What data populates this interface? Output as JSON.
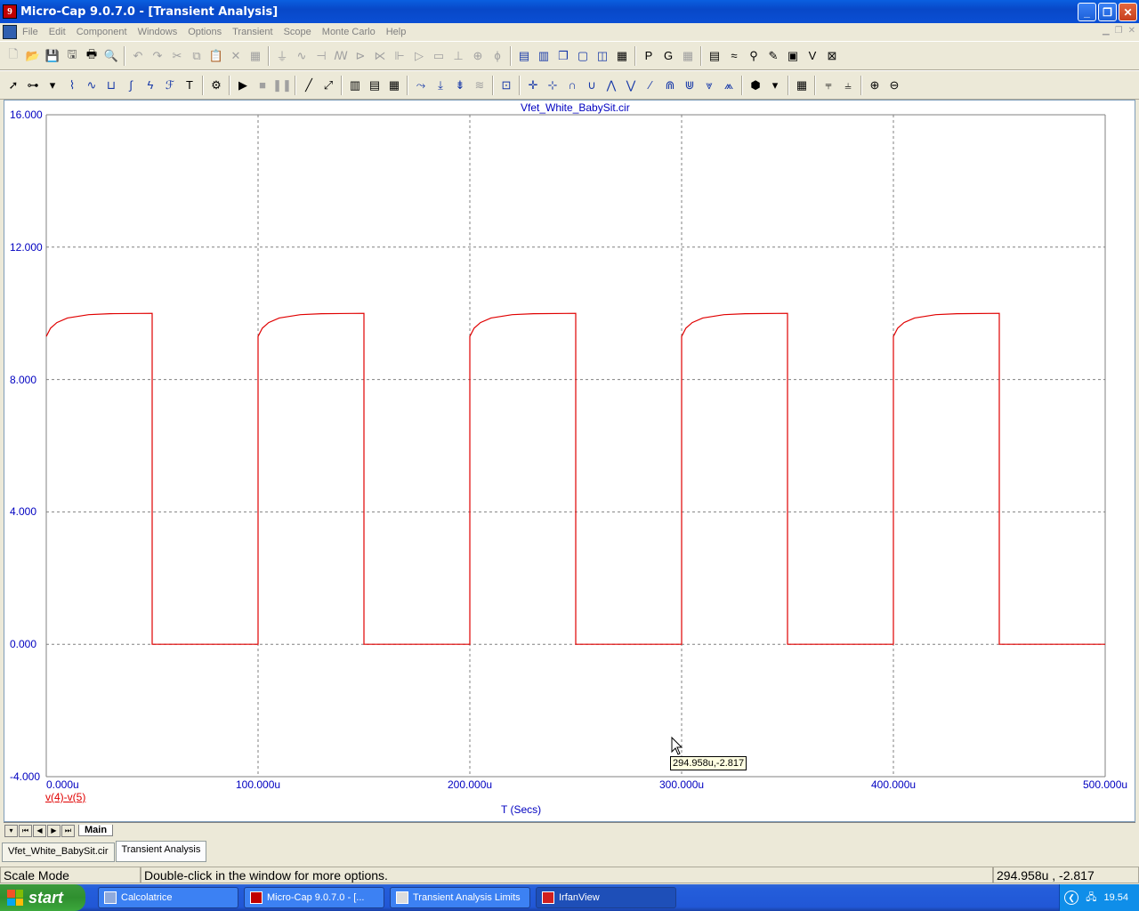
{
  "window": {
    "title": "Micro-Cap 9.0.7.0 - [Transient Analysis]",
    "app_icon_glyph": "9",
    "minimize_glyph": "_",
    "restore_glyph": "❐",
    "close_glyph": "✕"
  },
  "menu": {
    "items": [
      "File",
      "Edit",
      "Component",
      "Windows",
      "Options",
      "Transient",
      "Scope",
      "Monte Carlo",
      "Help"
    ]
  },
  "plot": {
    "title": "Vfet_White_BabySit.cir",
    "y_ticks": [
      "16.000",
      "12.000",
      "8.000",
      "4.000",
      "0.000",
      "-4.000"
    ],
    "x_ticks": [
      "0.000u",
      "100.000u",
      "200.000u",
      "300.000u",
      "400.000u",
      "500.000u"
    ],
    "x_axis_title": "T (Secs)",
    "trace_label": "v(4)-v(5)",
    "trace_color": "#e00000",
    "cursor_tooltip": "294.958u,-2.817"
  },
  "chart_data": {
    "type": "line",
    "title": "Vfet_White_BabySit.cir",
    "xlabel": "T (Secs)",
    "ylabel": "",
    "xlim": [
      0,
      500
    ],
    "ylim": [
      -4,
      16
    ],
    "x_unit": "u",
    "grid": true,
    "series": [
      {
        "name": "v(4)-v(5)",
        "period": 100,
        "high_duration": 50,
        "points": [
          [
            0,
            9.3
          ],
          [
            2,
            9.55
          ],
          [
            5,
            9.72
          ],
          [
            10,
            9.86
          ],
          [
            20,
            9.96
          ],
          [
            30,
            9.99
          ],
          [
            50,
            10.0
          ],
          [
            50,
            0
          ],
          [
            100,
            0
          ],
          [
            100,
            9.3
          ],
          [
            102,
            9.55
          ],
          [
            105,
            9.72
          ],
          [
            110,
            9.86
          ],
          [
            120,
            9.96
          ],
          [
            130,
            9.99
          ],
          [
            150,
            10.0
          ],
          [
            150,
            0
          ],
          [
            200,
            0
          ],
          [
            200,
            9.3
          ],
          [
            202,
            9.55
          ],
          [
            205,
            9.72
          ],
          [
            210,
            9.86
          ],
          [
            220,
            9.96
          ],
          [
            230,
            9.99
          ],
          [
            250,
            10.0
          ],
          [
            250,
            0
          ],
          [
            300,
            0
          ],
          [
            300,
            9.3
          ],
          [
            302,
            9.55
          ],
          [
            305,
            9.72
          ],
          [
            310,
            9.86
          ],
          [
            320,
            9.96
          ],
          [
            330,
            9.99
          ],
          [
            350,
            10.0
          ],
          [
            350,
            0
          ],
          [
            400,
            0
          ],
          [
            400,
            9.3
          ],
          [
            402,
            9.55
          ],
          [
            405,
            9.72
          ],
          [
            410,
            9.86
          ],
          [
            420,
            9.96
          ],
          [
            430,
            9.99
          ],
          [
            450,
            10.0
          ],
          [
            450,
            0
          ],
          [
            500,
            0
          ]
        ]
      }
    ]
  },
  "sheet_tabs": {
    "main": "Main"
  },
  "doc_tabs": [
    "Vfet_White_BabySit.cir",
    "Transient Analysis"
  ],
  "status": {
    "mode": "Scale Mode",
    "hint": "Double-click in the window for more options.",
    "coords": "294.958u , -2.817"
  },
  "taskbar": {
    "start_label": "start",
    "buttons": [
      "Calcolatrice",
      "Micro-Cap 9.0.7.0 - [...",
      "Transient Analysis Limits",
      "IrfanView"
    ],
    "clock": "19.54"
  }
}
